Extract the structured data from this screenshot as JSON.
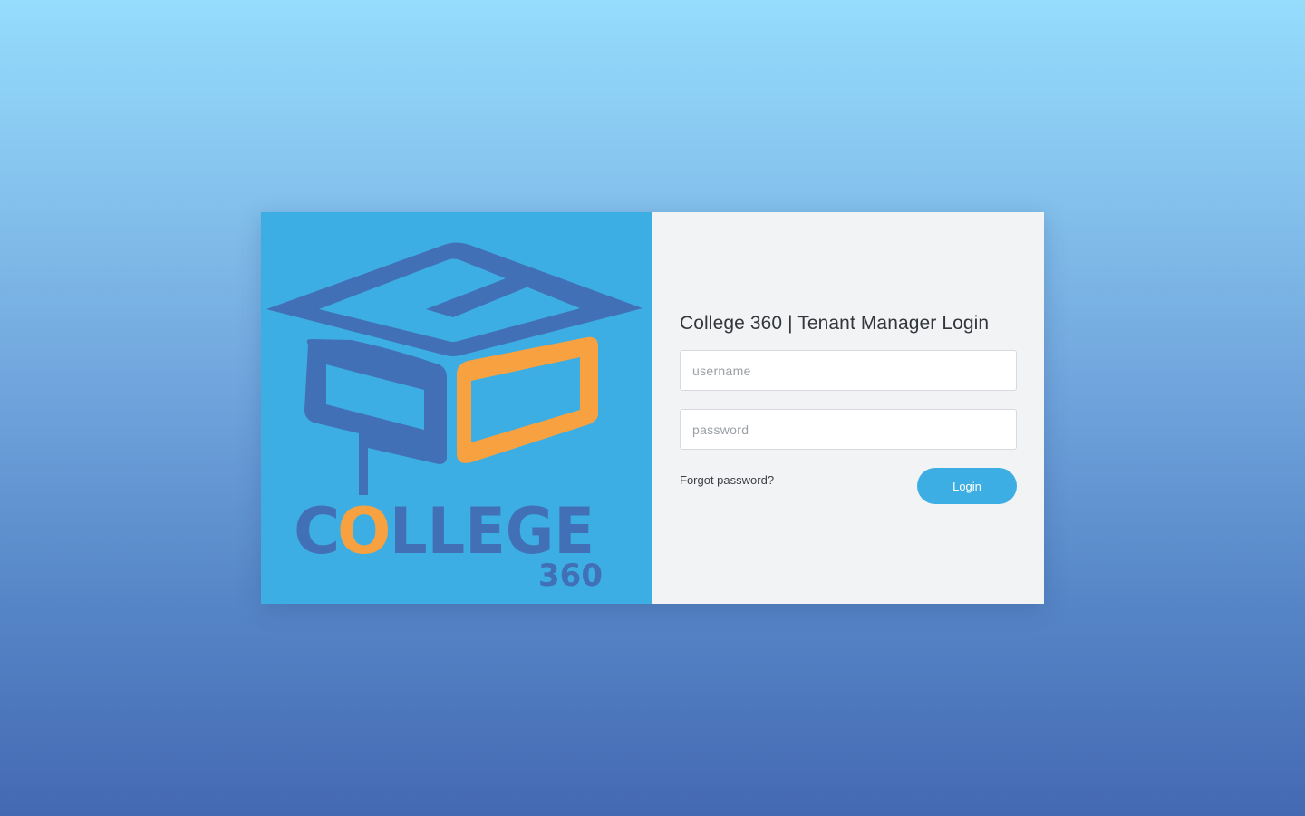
{
  "logo": {
    "icon": "college-360-graduation-cap-logo",
    "text_c": "C",
    "text_o": "O",
    "text_llege": "LLEGE",
    "subtext": "360",
    "colors": {
      "background": "#3daee3",
      "primary": "#4270b6",
      "accent": "#f7a140"
    }
  },
  "login": {
    "title": "College 360 | Tenant Manager Login",
    "username_placeholder": "username",
    "password_placeholder": "password",
    "forgot_password_label": "Forgot password?",
    "login_label": "Login"
  },
  "colors": {
    "button": "#3daee3",
    "panel_background": "#f2f3f5"
  }
}
